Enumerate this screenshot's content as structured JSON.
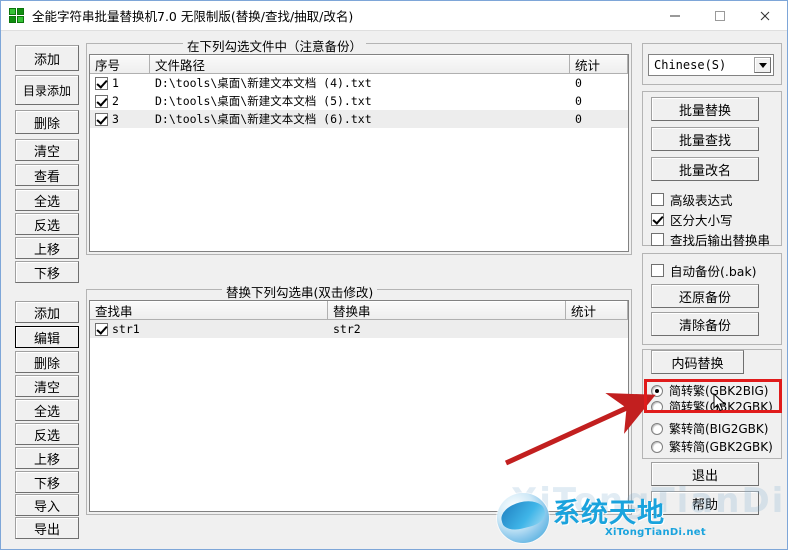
{
  "window": {
    "title": "全能字符串批量替换机7.0 无限制版(替换/查找/抽取/改名)",
    "icon": "app-puzzle-icon",
    "minimize": "—",
    "maximize": "☐",
    "close": "✕"
  },
  "file_panel": {
    "group_title": "在下列勾选文件中（注意备份）",
    "buttons": [
      {
        "label": "添加",
        "name": "file-add-button"
      },
      {
        "label": "目录添加",
        "name": "file-add-dir-button"
      },
      {
        "label": "删除",
        "name": "file-delete-button"
      },
      {
        "label": "清空",
        "name": "file-clear-button"
      },
      {
        "label": "查看",
        "name": "file-view-button"
      },
      {
        "label": "全选",
        "name": "file-select-all-button"
      },
      {
        "label": "反选",
        "name": "file-invert-selection-button"
      },
      {
        "label": "上移",
        "name": "file-move-up-button"
      },
      {
        "label": "下移",
        "name": "file-move-down-button"
      }
    ],
    "columns": [
      "序号",
      "文件路径",
      "统计"
    ],
    "rows": [
      {
        "checked": true,
        "index": "1",
        "path": "D:\\tools\\桌面\\新建文本文档 (4).txt",
        "count": "0",
        "selected": false
      },
      {
        "checked": true,
        "index": "2",
        "path": "D:\\tools\\桌面\\新建文本文档 (5).txt",
        "count": "0",
        "selected": false
      },
      {
        "checked": true,
        "index": "3",
        "path": "D:\\tools\\桌面\\新建文本文档 (6).txt",
        "count": "0",
        "selected": true
      }
    ]
  },
  "string_panel": {
    "group_title": "替换下列勾选串(双击修改)",
    "buttons": [
      {
        "label": "添加",
        "name": "str-add-button",
        "focused": false
      },
      {
        "label": "编辑",
        "name": "str-edit-button",
        "focused": true
      },
      {
        "label": "删除",
        "name": "str-delete-button",
        "focused": false
      },
      {
        "label": "清空",
        "name": "str-clear-button",
        "focused": false
      },
      {
        "label": "全选",
        "name": "str-select-all-button",
        "focused": false
      },
      {
        "label": "反选",
        "name": "str-invert-selection-button",
        "focused": false
      },
      {
        "label": "上移",
        "name": "str-move-up-button",
        "focused": false
      },
      {
        "label": "下移",
        "name": "str-move-down-button",
        "focused": false
      },
      {
        "label": "导入",
        "name": "str-import-button",
        "focused": false
      },
      {
        "label": "导出",
        "name": "str-export-button",
        "focused": false
      }
    ],
    "columns": [
      "查找串",
      "替换串",
      "统计"
    ],
    "rows": [
      {
        "checked": true,
        "find": "str1",
        "replace": "str2",
        "count": ""
      }
    ]
  },
  "right_panel": {
    "language": {
      "value": "Chinese(S)",
      "arrow": "chevron-down-icon"
    },
    "action_buttons": [
      {
        "label": "批量替换",
        "name": "batch-replace-button"
      },
      {
        "label": "批量查找",
        "name": "batch-find-button"
      },
      {
        "label": "批量改名",
        "name": "batch-rename-button"
      }
    ],
    "options": [
      {
        "label": "高级表达式",
        "checked": false,
        "name": "advanced-expression-checkbox"
      },
      {
        "label": "区分大小写",
        "checked": true,
        "name": "case-sensitive-checkbox"
      },
      {
        "label": "查找后输出替换串",
        "checked": false,
        "name": "output-after-find-checkbox"
      }
    ],
    "backup": {
      "auto_backup": {
        "label": "自动备份(.bak)",
        "checked": false
      },
      "buttons": [
        {
          "label": "还原备份",
          "name": "restore-backup-button"
        },
        {
          "label": "清除备份",
          "name": "clear-backup-button"
        }
      ]
    },
    "encoding": {
      "title_button": {
        "label": "内码替换",
        "name": "encoding-replace-button"
      },
      "radios": [
        {
          "label": "简转繁(GBK2BIG)",
          "selected": true,
          "name": "radio-gbk2big"
        },
        {
          "label": "简转繁(GBK2GBK)",
          "selected": false,
          "name": "radio-gbk2gbk"
        },
        {
          "label": "繁转简(BIG2GBK)",
          "selected": false,
          "name": "radio-big2gbk"
        },
        {
          "label": "繁转简(GBK2GBK)",
          "selected": false,
          "name": "radio-big-gbk2gbk"
        }
      ]
    },
    "footer_buttons": [
      {
        "label": "退出",
        "name": "exit-button"
      },
      {
        "label": "帮助",
        "name": "help-button"
      }
    ]
  },
  "annotation": {
    "highlight_color": "#e01b1b",
    "arrow_from": "505,462",
    "arrow_to": "643,398"
  },
  "watermark": {
    "text": "系统天地",
    "subtext": "XiTongTianDi.net",
    "ghost": "XiTongTianDi",
    "color": "#1aa3dd"
  }
}
